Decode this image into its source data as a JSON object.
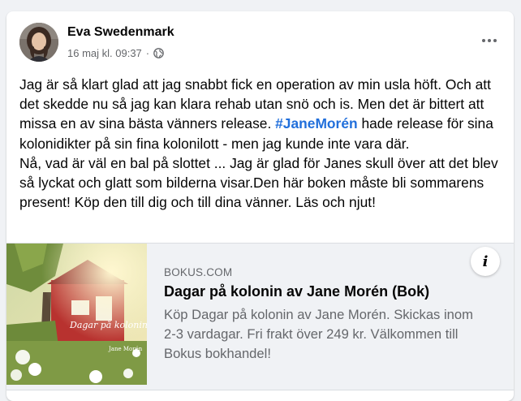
{
  "post": {
    "author": "Eva Swedenmark",
    "timestamp": "16 maj kl. 09:37",
    "separator": "·",
    "audience_icon": "globe-icon",
    "more_icon": "more-options-icon",
    "text": {
      "p1_before": "Jag är så klart glad att jag snabbt fick en operation av min usla höft. Och att det skedde nu så jag kan klara rehab utan snö och is. Men det är bittert att missa en av sina bästa vänners release. ",
      "hashtag": "#JaneMorén",
      "p1_after": " hade release för sina kolonidikter på sin fina kolonilott - men jag kunde inte vara där.",
      "p2": "Nå, vad är väl en bal på slottet ... Jag är glad för Janes skull över att det blev så lyckat och glatt som bilderna visar.Den här boken måste bli sommarens present! Köp den till dig och till dina vänner. Läs och njut!"
    }
  },
  "link_preview": {
    "domain": "BOKUS.COM",
    "title": "Dagar på kolonin av Jane Morén (Bok)",
    "description": "Köp Dagar på kolonin av Jane Morén. Skickas inom 2-3 vardagar. Fri frakt över 249 kr. Välkommen till Bokus bokhandel!",
    "info_icon": "info-icon",
    "cover": {
      "title": "Dagar på kolonin",
      "author": "Jane Morén"
    }
  },
  "colors": {
    "hashtag": "#216fdb",
    "secondary_text": "#65676b",
    "card_bg": "#ffffff",
    "page_bg": "#f0f2f5"
  }
}
